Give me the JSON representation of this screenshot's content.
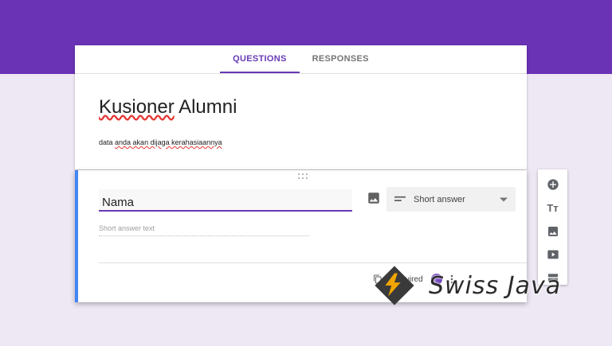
{
  "tabs": [
    {
      "label": "QUESTIONS",
      "active": true
    },
    {
      "label": "RESPONSES",
      "active": false
    }
  ],
  "form": {
    "title_underlined": "Kusioner",
    "title_rest": " Alumni",
    "description_prefix": "data ",
    "description_underlined": "anda akan dijaga kerahasiaannya"
  },
  "question": {
    "title_value": "Nama",
    "type_label": "Short answer",
    "answer_hint": "Short answer text",
    "required_label": "Required"
  },
  "toolbar": {
    "items": [
      "add-question-icon",
      "title-text-icon",
      "image-icon",
      "video-icon",
      "section-icon"
    ],
    "text_glyph": "Tт"
  },
  "watermark": {
    "text": "Swiss Java"
  },
  "colors": {
    "accent": "#673ab7",
    "band": "#6a32b5",
    "background": "#eee7f4",
    "active_border": "#4285f4"
  }
}
